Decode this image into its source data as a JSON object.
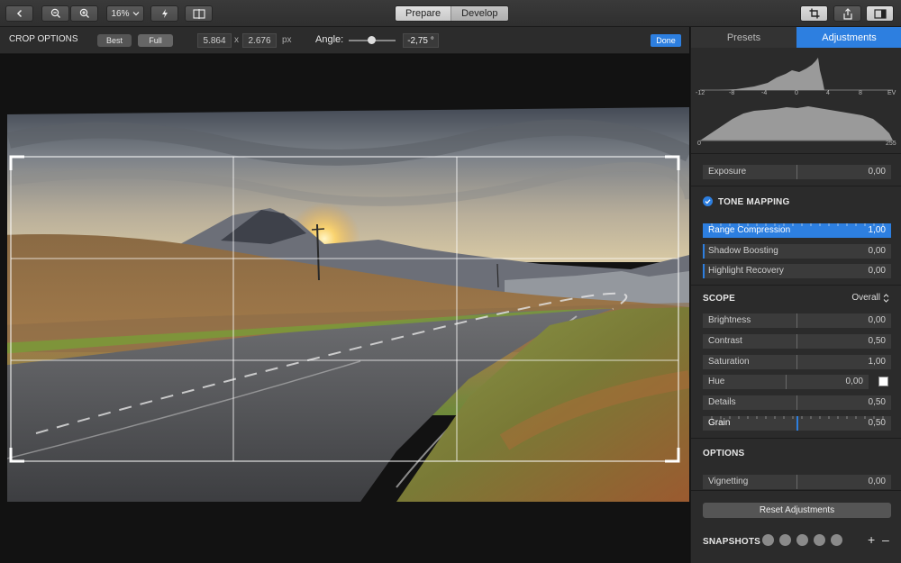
{
  "toolbar": {
    "zoom_label": "16%",
    "mode_prepare": "Prepare",
    "mode_develop": "Develop"
  },
  "crop": {
    "title": "CROP OPTIONS",
    "best": "Best",
    "full": "Full",
    "width": "5.864",
    "times": "x",
    "height": "2.676",
    "unit": "px",
    "angle_label": "Angle:",
    "angle_value": "-2,75 °",
    "angle_slider_fraction": 0.5,
    "done": "Done"
  },
  "panel": {
    "tab_presets": "Presets",
    "tab_adjustments": "Adjustments",
    "ev_ticks": [
      "-12",
      "-8",
      "-4",
      "0",
      "4",
      "8",
      "EV"
    ],
    "lum_min": "0",
    "lum_max": "255",
    "exposure": {
      "label": "Exposure",
      "value": "0,00",
      "fraction": 0.5
    },
    "tone_mapping_title": "TONE MAPPING",
    "tone_rows": [
      {
        "label": "Range Compression",
        "value": "1,00",
        "fraction": 1.0
      },
      {
        "label": "Shadow Boosting",
        "value": "0,00",
        "fraction": 0.0
      },
      {
        "label": "Highlight Recovery",
        "value": "0,00",
        "fraction": 0.0
      }
    ],
    "scope_title": "SCOPE",
    "scope_value": "Overall",
    "scope_rows": [
      {
        "label": "Brightness",
        "value": "0,00",
        "fraction": 0.5
      },
      {
        "label": "Contrast",
        "value": "0,50",
        "fraction": 0.5
      },
      {
        "label": "Saturation",
        "value": "1,00",
        "fraction": 0.5
      },
      {
        "label": "Hue",
        "value": "0,00",
        "fraction": 0.5
      },
      {
        "label": "Details",
        "value": "0,50",
        "fraction": 0.5
      },
      {
        "label": "Grain",
        "value": "0,50",
        "fraction": 0.5
      }
    ],
    "options_title": "OPTIONS",
    "vignetting": {
      "label": "Vignetting",
      "value": "0,00",
      "fraction": 0.5
    },
    "reset": "Reset Adjustments",
    "snapshots_title": "SNAPSHOTS",
    "snapshot_count": 5,
    "add": "+",
    "remove": "–"
  },
  "colors": {
    "accent": "#2d7fe0"
  }
}
